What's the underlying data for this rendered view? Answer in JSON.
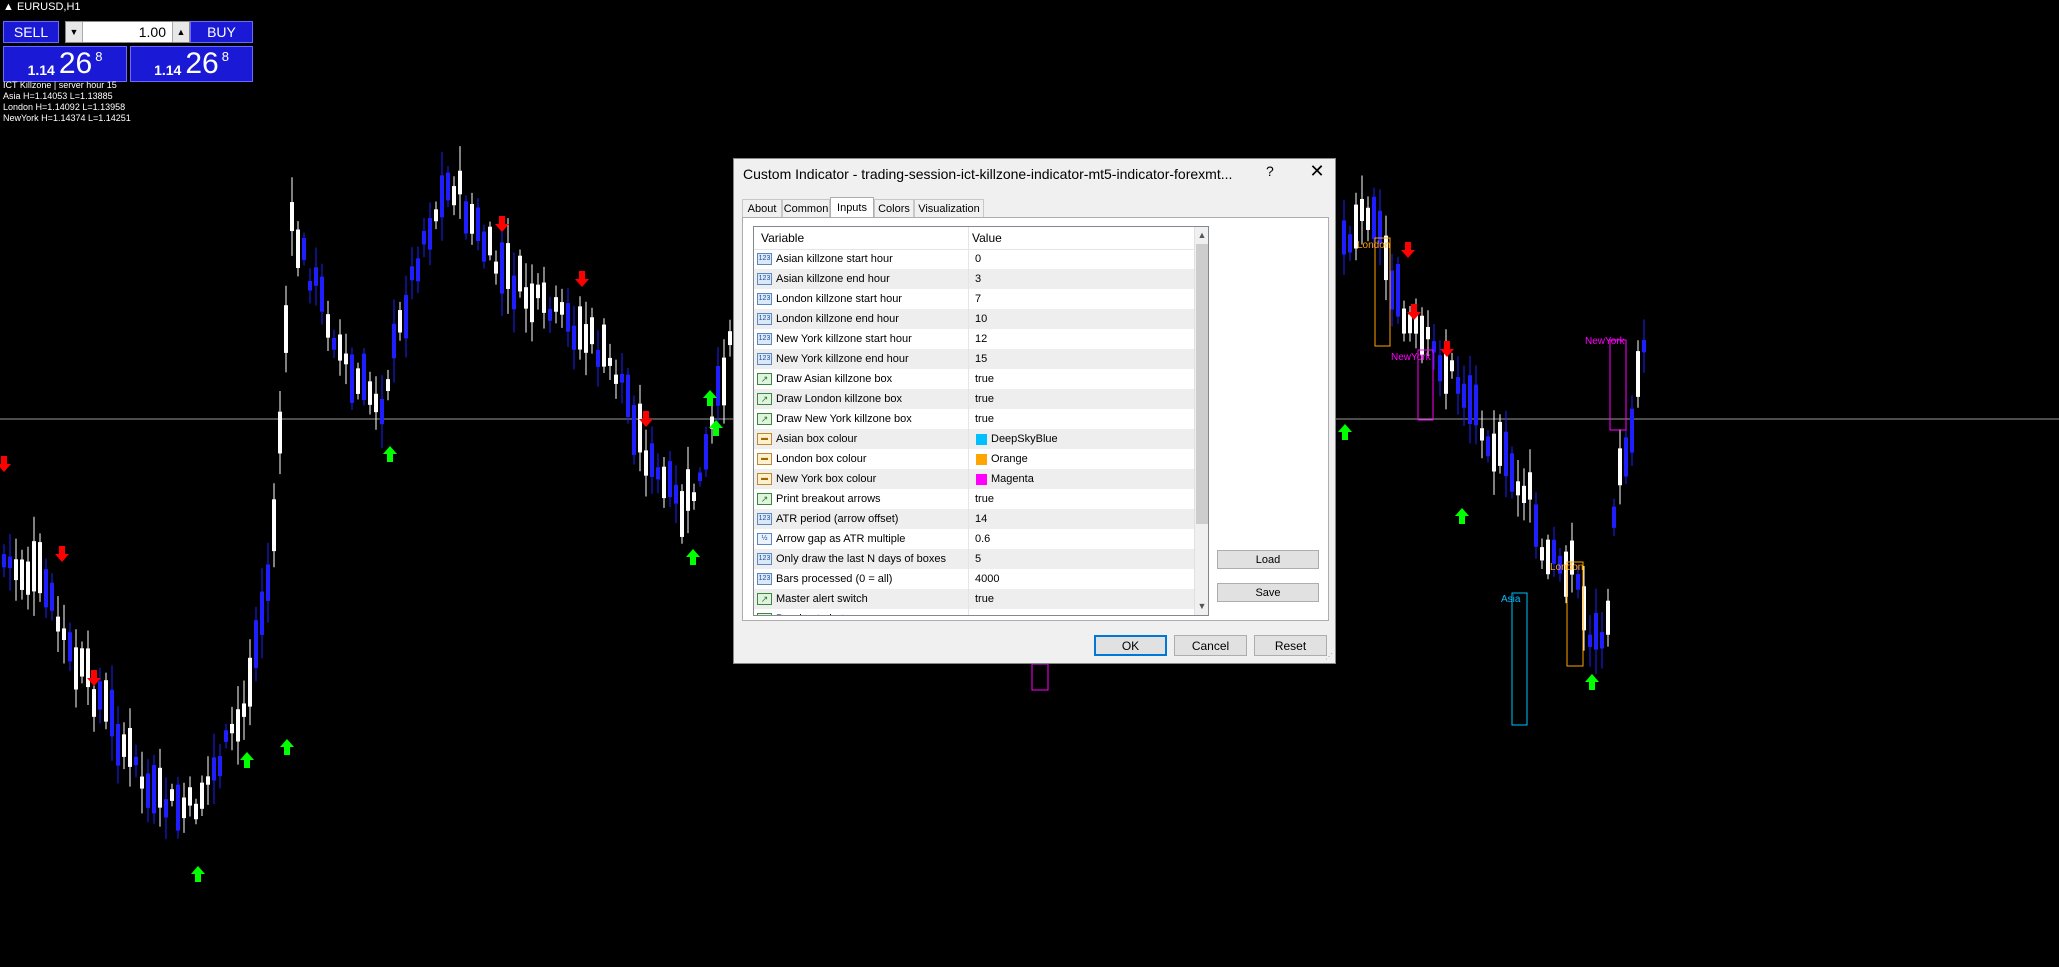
{
  "symbol_title": "EURUSD,H1",
  "trade_panel": {
    "sell_label": "SELL",
    "buy_label": "BUY",
    "lot_value": "1.00",
    "bid": {
      "small": "1.14",
      "big": "26",
      "sup": "8"
    },
    "ask": {
      "small": "1.14",
      "big": "26",
      "sup": "8"
    }
  },
  "info_lines": [
    "ICT Killzone | server hour 15",
    "Asia  H=1.14053  L=1.13885",
    "London  H=1.14092  L=1.13958",
    "NewYork  H=1.14374  L=1.14251"
  ],
  "chart_labels": {
    "london_right": "London",
    "newyork_right": "NewYork",
    "newyork_far": "NewYork",
    "asia_lower": "Asia",
    "london_lower": "London"
  },
  "colors": {
    "asia": "#00BFFF",
    "london": "#FFA500",
    "newyork": "#FF00FF",
    "bull_candle": "#1E1EFF",
    "bear_candle": "#FFFFFF",
    "arrow_up": "#00FF00",
    "arrow_down": "#FF0000"
  },
  "dialog": {
    "title": "Custom Indicator - trading-session-ict-killzone-indicator-mt5-indicator-forexmt...",
    "help": "?",
    "close": "✕",
    "tabs": [
      "About",
      "Common",
      "Inputs",
      "Colors",
      "Visualization"
    ],
    "active_tab": "Inputs",
    "columns": {
      "variable": "Variable",
      "value": "Value"
    },
    "rows": [
      {
        "type": "int",
        "variable": "Asian killzone start hour",
        "value": "0"
      },
      {
        "type": "int",
        "variable": "Asian killzone end hour",
        "value": "3"
      },
      {
        "type": "int",
        "variable": "London killzone start hour",
        "value": "7"
      },
      {
        "type": "int",
        "variable": "London killzone end hour",
        "value": "10"
      },
      {
        "type": "int",
        "variable": "New York killzone start hour",
        "value": "12"
      },
      {
        "type": "int",
        "variable": "New York killzone end hour",
        "value": "15"
      },
      {
        "type": "bool",
        "variable": "Draw Asian killzone box",
        "value": "true"
      },
      {
        "type": "bool",
        "variable": "Draw London killzone box",
        "value": "true"
      },
      {
        "type": "bool",
        "variable": "Draw New York killzone box",
        "value": "true"
      },
      {
        "type": "color",
        "variable": "Asian box colour",
        "value": "DeepSkyBlue",
        "swatch": "#00BFFF"
      },
      {
        "type": "color",
        "variable": "London box colour",
        "value": "Orange",
        "swatch": "#FFA500"
      },
      {
        "type": "color",
        "variable": "New York box colour",
        "value": "Magenta",
        "swatch": "#FF00FF"
      },
      {
        "type": "bool",
        "variable": "Print breakout arrows",
        "value": "true"
      },
      {
        "type": "int",
        "variable": "ATR period (arrow offset)",
        "value": "14"
      },
      {
        "type": "double",
        "variable": "Arrow gap as ATR multiple",
        "value": "0.6"
      },
      {
        "type": "int",
        "variable": "Only draw the last N days of boxes",
        "value": "5"
      },
      {
        "type": "int",
        "variable": "Bars processed (0 = all)",
        "value": "4000"
      },
      {
        "type": "bool",
        "variable": "Master alert switch",
        "value": "true"
      },
      {
        "type": "bool",
        "variable": "Breakout alert",
        "value": ""
      }
    ],
    "icon_glyphs": {
      "int": "123",
      "bool": "↗",
      "color": "▬",
      "double": "½"
    },
    "load_label": "Load",
    "save_label": "Save",
    "ok_label": "OK",
    "cancel_label": "Cancel",
    "reset_label": "Reset"
  }
}
